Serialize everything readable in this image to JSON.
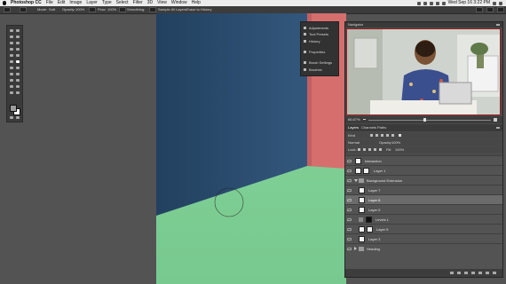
{
  "menubar": {
    "apple_icon": "apple-icon",
    "app_name": "Photoshop CC",
    "menus": [
      "File",
      "Edit",
      "Image",
      "Layer",
      "Type",
      "Select",
      "Filter",
      "3D",
      "View",
      "Window",
      "Help"
    ],
    "clock": "Wed Sep 16 3:22 PM"
  },
  "options_bar": {
    "mode_label": "Mode:",
    "mode_value": "Soft",
    "opacity_label": "Opacity:",
    "opacity_value": "100%",
    "flow_label": "Flow:",
    "flow_value": "100%",
    "smoothing_label": "Smoothing:",
    "sample_label": "Sample All Layers",
    "erase_label": "Erase to History"
  },
  "float_panel": {
    "items": [
      {
        "label": "Adjustments",
        "icon": "adjustments-icon"
      },
      {
        "label": "Tool Presets",
        "icon": "tool-presets-icon"
      },
      {
        "label": "History",
        "icon": "history-icon"
      },
      {
        "label": "Properties",
        "icon": "properties-icon"
      },
      {
        "label": "Brush Settings",
        "icon": "brush-settings-icon"
      },
      {
        "label": "Brushes",
        "icon": "brushes-icon"
      }
    ]
  },
  "navigator": {
    "title": "Navigator",
    "zoom": "66.67%"
  },
  "layers_panel": {
    "tabs": [
      "Layers",
      "Channels",
      "Paths"
    ],
    "kind_label": "Kind",
    "blend_mode": "Normal",
    "opacity_label": "Opacity:",
    "opacity_value": "100%",
    "lock_label": "Lock:",
    "fill_label": "Fill:",
    "fill_value": "100%",
    "layers": [
      {
        "name": "Interaction",
        "thumb": "light",
        "selected": false
      },
      {
        "name": "Layer 1",
        "thumb": "light",
        "selected": false
      },
      {
        "name": "Background Extension",
        "thumb": "folder",
        "selected": false
      },
      {
        "name": "Layer 7",
        "thumb": "light",
        "selected": false
      },
      {
        "name": "Layer 8",
        "thumb": "light",
        "selected": true
      },
      {
        "name": "Layer 9",
        "thumb": "light",
        "selected": false
      },
      {
        "name": "Levels 1",
        "thumb": "dark",
        "selected": false
      },
      {
        "name": "Layer 5",
        "thumb": "light",
        "selected": false
      },
      {
        "name": "Layer 3",
        "thumb": "light",
        "selected": false
      },
      {
        "name": "Heading",
        "thumb": "folder",
        "selected": false
      }
    ]
  },
  "colors": {
    "canvas_blue": "#2b4a6b",
    "canvas_green": "#7ecf95",
    "canvas_pink": "#d66e6e",
    "selection_border": "#9a1f1f"
  }
}
